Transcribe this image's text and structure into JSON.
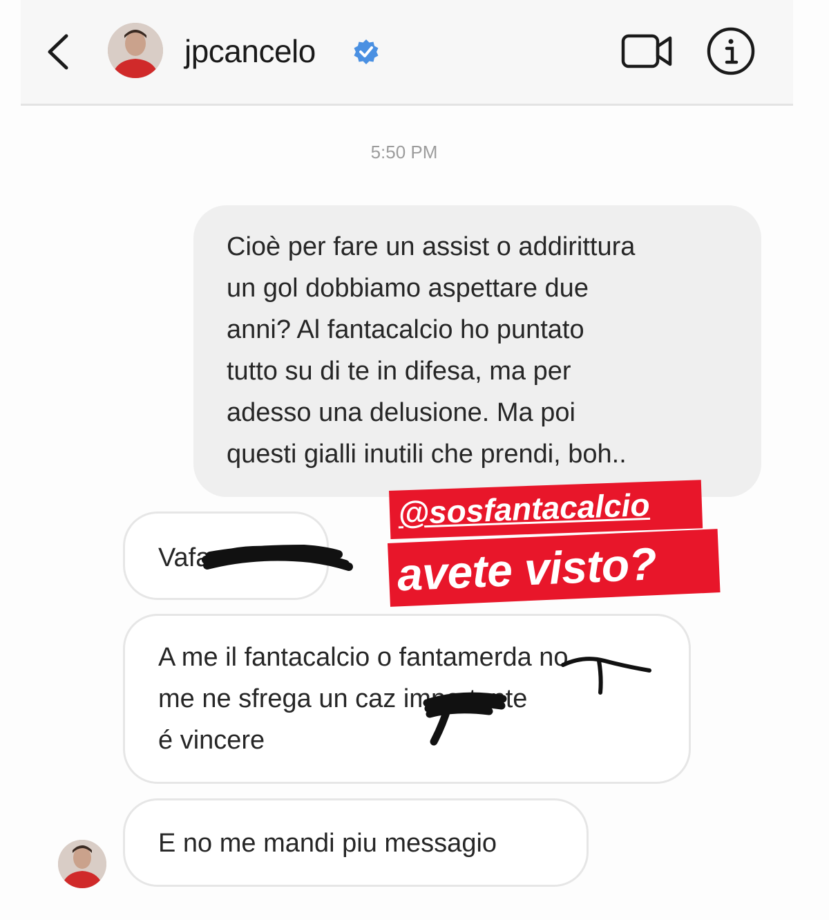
{
  "header": {
    "username": "jpcancelo",
    "back_icon": "chevron-left-icon",
    "verified_icon": "verified-badge-icon",
    "video_icon": "video-camera-icon",
    "info_icon": "info-icon",
    "verified_color": "#3897f0"
  },
  "conversation": {
    "timestamp": "5:50 PM",
    "messages": [
      {
        "from": "me",
        "text": "Cioè per fare un assist o addirittura\nun gol dobbiamo aspettare due\nanni? Al fantacalcio ho puntato\ntutto su di te in difesa, ma per\nadesso una delusione. Ma poi\nquesti gialli inutili che prendi, boh.."
      },
      {
        "from": "them",
        "text": "Vafa"
      },
      {
        "from": "them",
        "text": "A me il fantacalcio o fantamerda no\nme ne sfrega un caz importante\né vincere"
      },
      {
        "from": "them",
        "text": "E no me mandi piu messagio"
      }
    ]
  },
  "sticker": {
    "line1": "@sosfantacalcio",
    "line2": "avete visto?",
    "color": "#e8162a"
  }
}
